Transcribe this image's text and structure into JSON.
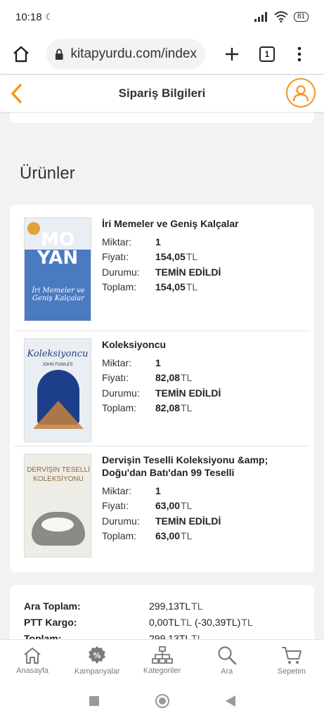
{
  "status": {
    "time": "10:18",
    "battery": "81"
  },
  "browser": {
    "url": "kitapyurdu.com/index",
    "tab_count": "1"
  },
  "header": {
    "title": "Sipariş Bilgileri"
  },
  "section": {
    "title": "Ürünler"
  },
  "labels": {
    "qty": "Miktar:",
    "price": "Fiyatı:",
    "status": "Durumu:",
    "total": "Toplam:",
    "currency": "TL"
  },
  "products": [
    {
      "name": "İri Memeler ve Geniş Kalçalar",
      "qty": "1",
      "price": "154,05",
      "status": "TEMİN EDİLDİ",
      "total": "154,05",
      "cover_title": "MO YAN",
      "cover_subtitle": "İri Memeler ve Geniş Kalçalar"
    },
    {
      "name": "Koleksiyoncu",
      "qty": "1",
      "price": "82,08",
      "status": "TEMİN EDİLDİ",
      "total": "82,08",
      "cover_title": "Koleksiyoncu",
      "cover_subtitle": "JOHN FOWLES"
    },
    {
      "name": "Dervişin Teselli Koleksiyonu &amp; Doğu'dan Batı'dan 99 Teselli",
      "qty": "1",
      "price": "63,00",
      "status": "TEMİN EDİLDİ",
      "total": "63,00",
      "cover_title": "DERVİŞİN TESELLİ KOLEKSİYONU",
      "cover_subtitle": ""
    }
  ],
  "totals": {
    "subtotal_label": "Ara Toplam:",
    "subtotal_value": "299,13TL",
    "shipping_label": "PTT Kargo:",
    "shipping_value": "0,00TL",
    "shipping_discount": "(-30,39TL)",
    "grand_label": "Toplam:",
    "grand_value": "299,13TL"
  },
  "nav": {
    "home": "Anasayfa",
    "campaigns": "Kampanyalar",
    "categories": "Kategoriler",
    "search": "Ara",
    "cart": "Sepetim"
  },
  "colors": {
    "accent": "#f7941d",
    "nav_icon": "#7a7a7a"
  }
}
